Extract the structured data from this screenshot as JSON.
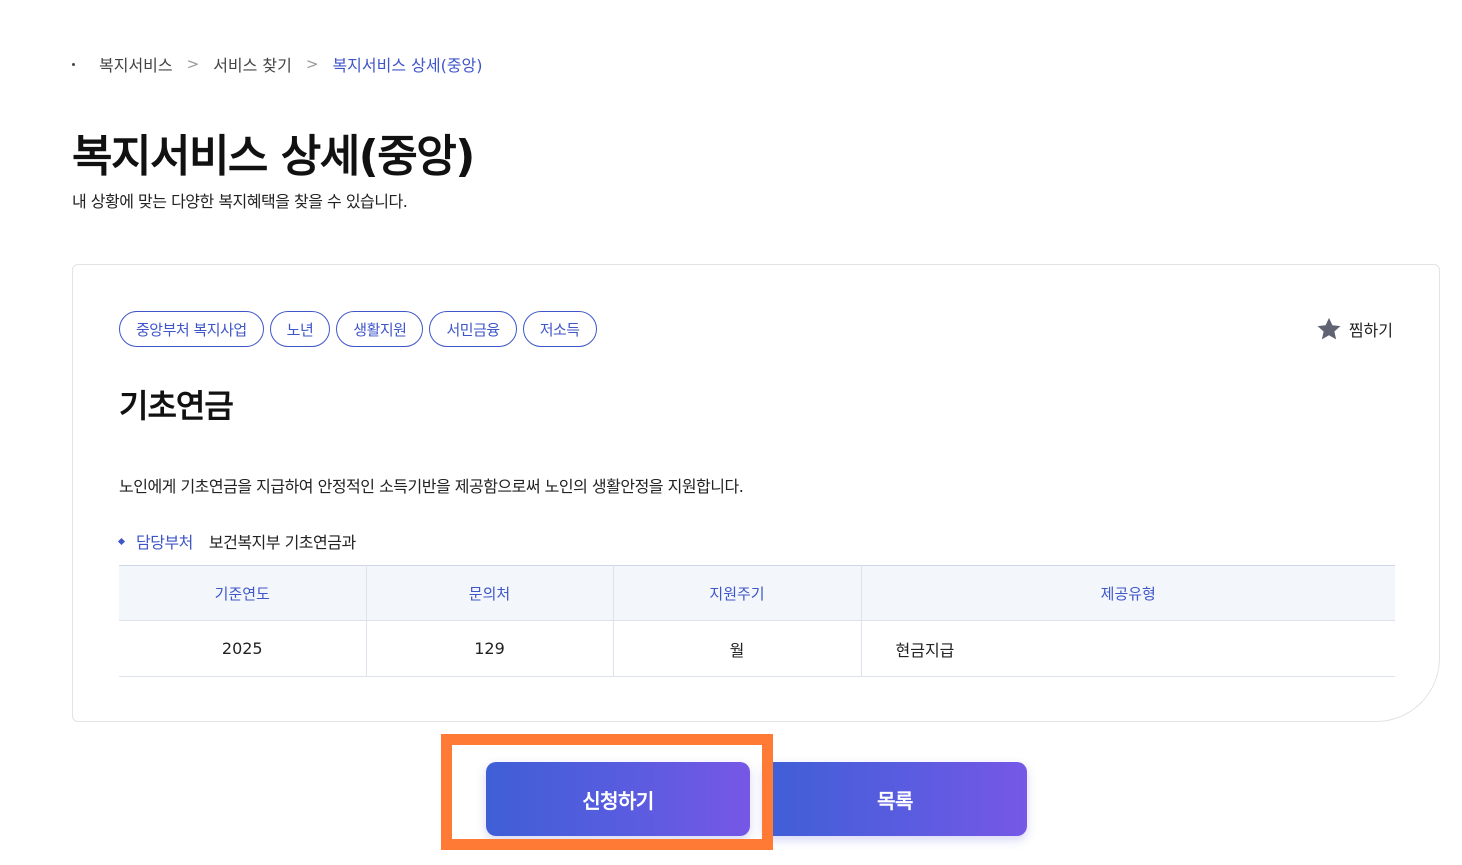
{
  "breadcrumb": {
    "items": [
      "복지서비스",
      "서비스 찾기",
      "복지서비스 상세(중앙)"
    ],
    "separator": ">"
  },
  "header": {
    "title": "복지서비스 상세(중앙)",
    "subtitle": "내 상황에 맞는 다양한 복지혜택을 찾을 수 있습니다."
  },
  "service": {
    "tags": [
      "중앙부처 복지사업",
      "노년",
      "생활지원",
      "서민금융",
      "저소득"
    ],
    "bookmark_label": "찜하기",
    "name": "기초연금",
    "description": "노인에게 기초연금을 지급하여 안정적인 소득기반을 제공함으로써 노인의 생활안정을 지원합니다.",
    "dept_label": "담당부처",
    "dept_value": "보건복지부 기초연금과",
    "table": {
      "headers": [
        "기준연도",
        "문의처",
        "지원주기",
        "제공유형"
      ],
      "row": [
        "2025",
        "129",
        "월",
        "현금지급"
      ]
    }
  },
  "buttons": {
    "apply_label": "신청하기",
    "list_label": "목록"
  },
  "colors": {
    "accent": "#3f56c9",
    "highlight": "#ff7a35",
    "button_start": "#3f5fd6",
    "button_end": "#7657e6",
    "table_header_bg": "#f3f6fb"
  },
  "icons": {
    "bookmark": "star-icon",
    "separator": "chevron-right-icon"
  }
}
